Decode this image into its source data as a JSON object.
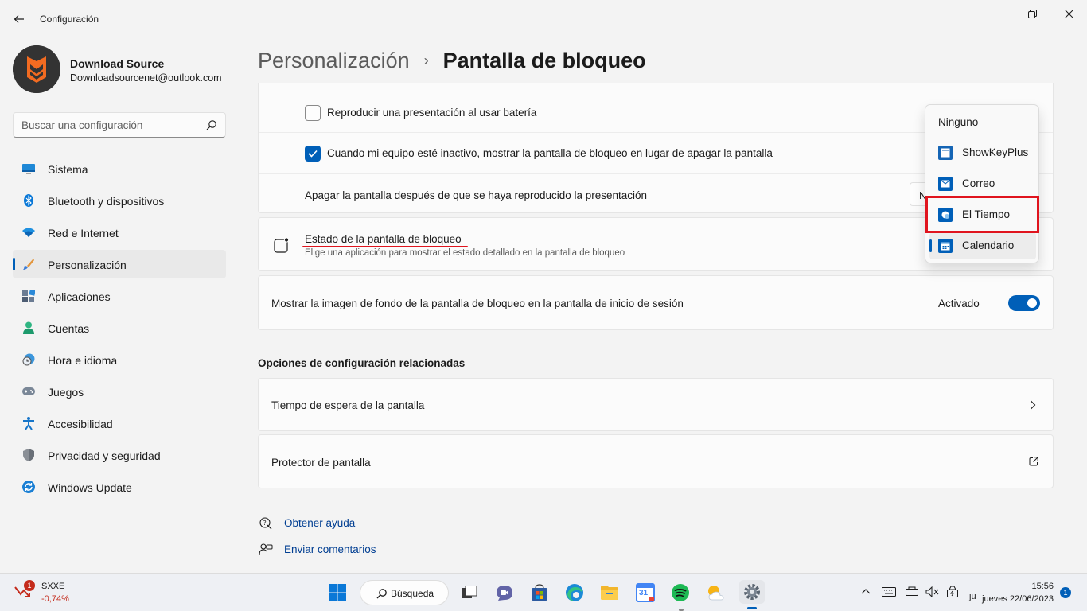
{
  "window": {
    "title": "Configuración"
  },
  "profile": {
    "name": "Download Source",
    "email": "Downloadsourcenet@outlook.com"
  },
  "search": {
    "placeholder": "Buscar una configuración"
  },
  "nav": {
    "items": [
      {
        "label": "Sistema",
        "icon": "monitor-icon"
      },
      {
        "label": "Bluetooth y dispositivos",
        "icon": "bluetooth-icon"
      },
      {
        "label": "Red e Internet",
        "icon": "wifi-icon"
      },
      {
        "label": "Personalización",
        "icon": "paintbrush-icon",
        "active": true
      },
      {
        "label": "Aplicaciones",
        "icon": "apps-icon"
      },
      {
        "label": "Cuentas",
        "icon": "person-icon"
      },
      {
        "label": "Hora e idioma",
        "icon": "clock-globe-icon"
      },
      {
        "label": "Juegos",
        "icon": "gamepad-icon"
      },
      {
        "label": "Accesibilidad",
        "icon": "accessibility-icon"
      },
      {
        "label": "Privacidad y seguridad",
        "icon": "shield-icon"
      },
      {
        "label": "Windows Update",
        "icon": "refresh-icon"
      }
    ]
  },
  "breadcrumb": {
    "parent": "Personalización",
    "separator": "›",
    "current": "Pantalla de bloqueo"
  },
  "slideshow": {
    "battery_label": "Reproducir una presentación al usar batería",
    "battery_checked": false,
    "inactive_label": "Cuando mi equipo esté inactivo, mostrar la pantalla de bloqueo en lugar de apagar la pantalla",
    "inactive_checked": true,
    "turnoff_label": "Apagar la pantalla después de que se haya reproducido la presentación",
    "turnoff_value_partial": "N"
  },
  "lock_status": {
    "title": "Estado de la pantalla de bloqueo",
    "subtitle": "Elige una aplicación para mostrar el estado detallado en la pantalla de bloqueo"
  },
  "background_on_signin": {
    "label": "Mostrar la imagen de fondo de la pantalla de bloqueo en la pantalla de inicio de sesión",
    "state": "Activado",
    "on": true
  },
  "related": {
    "title": "Opciones de configuración relacionadas",
    "timeout": "Tiempo de espera de la pantalla",
    "screensaver": "Protector de pantalla"
  },
  "help": {
    "get_help": "Obtener ayuda",
    "feedback": "Enviar comentarios"
  },
  "dropdown": {
    "options": [
      {
        "label": "Ninguno",
        "icon": ""
      },
      {
        "label": "ShowKeyPlus",
        "icon": "showkeyplus-icon"
      },
      {
        "label": "Correo",
        "icon": "mail-icon"
      },
      {
        "label": "El Tiempo",
        "icon": "weather-icon",
        "highlighted": true
      },
      {
        "label": "Calendario",
        "icon": "calendar-icon",
        "selected": true
      }
    ]
  },
  "taskbar": {
    "stock_ticker": "SXXE",
    "stock_change": "-0,74%",
    "stock_badge": "1",
    "search_label": "Búsqueda",
    "calendar_day": "31",
    "time": "15:56",
    "date": "jueves 22/06/2023",
    "date_prefix": "ju",
    "notification_count": "1"
  },
  "colors": {
    "accent": "#005fb8",
    "highlight_box": "#e0141e",
    "link": "#003e92"
  }
}
